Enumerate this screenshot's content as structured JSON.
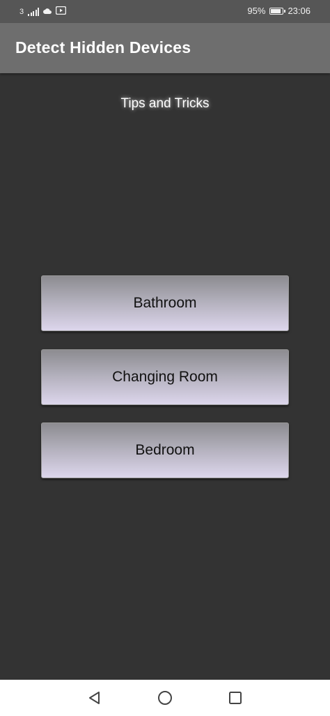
{
  "status_bar": {
    "carrier": "3",
    "battery_percent": "95%",
    "battery_level": 0.95,
    "time": "23:06",
    "icons": [
      "signal-icon",
      "cloud-icon",
      "youtube-icon",
      "battery-icon"
    ]
  },
  "app_bar": {
    "title": "Detect Hidden Devices",
    "background_color": "#6e6e6e"
  },
  "main": {
    "tips_label": "Tips and Tricks",
    "buttons": [
      {
        "label": "Bathroom"
      },
      {
        "label": "Changing Room"
      },
      {
        "label": "Bedroom"
      }
    ]
  },
  "nav_bar": {
    "icons": [
      "back-icon",
      "home-icon",
      "recents-icon"
    ]
  },
  "colors": {
    "background": "#333333",
    "status_bar": "#565656",
    "button_gradient_top": "#8c8b90",
    "button_gradient_bottom": "#dcd6ec"
  }
}
